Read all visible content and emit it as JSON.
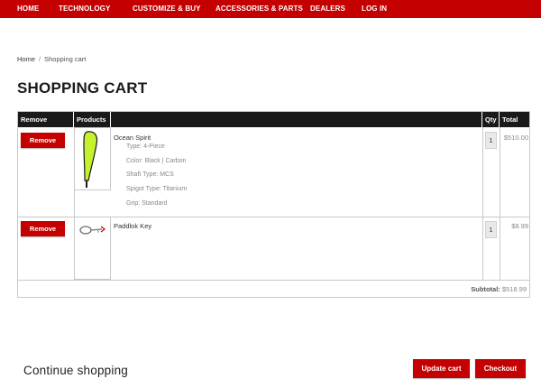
{
  "nav": {
    "items": [
      "Home",
      "Technology",
      "Customize & Buy",
      "Accessories & Parts",
      "Dealers",
      "Log In"
    ]
  },
  "breadcrumb": {
    "home": "Home",
    "separator": "/",
    "current": "Shopping cart"
  },
  "page": {
    "title": "SHOPPING CART"
  },
  "cart": {
    "headers": {
      "remove": "Remove",
      "products": "Products",
      "qty": "Qty",
      "total": "Total"
    },
    "remove_label": "Remove",
    "items": [
      {
        "name": "Ocean Spirit",
        "image_icon": "paddle-blade-icon",
        "options": [
          "Type: 4-Piece",
          "Color: Black | Carbon",
          "Shaft Type: MCS",
          "Spigot Type: Titanium",
          "Grip: Standard"
        ],
        "qty": "1",
        "total": "$510.00"
      },
      {
        "name": "Paddlok Key",
        "image_icon": "key-icon",
        "options": [],
        "qty": "1",
        "total": "$8.99"
      }
    ],
    "subtotal_label": "Subtotal:",
    "subtotal_value": "$518.99"
  },
  "actions": {
    "continue": "Continue shopping",
    "update": "Update cart",
    "checkout": "Checkout"
  },
  "colors": {
    "brand_red": "#c40000",
    "header_black": "#1a1a1a",
    "border": "#c8c8c8"
  }
}
